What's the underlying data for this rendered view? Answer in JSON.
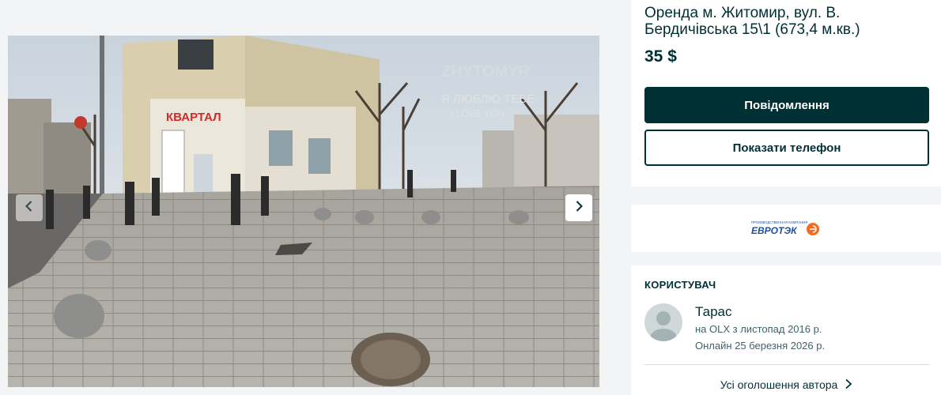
{
  "listing": {
    "title": "Оренда м. Житомир, вул. В. Бердичівська 15\\1 (673,4 м.кв.)",
    "price": "35 $"
  },
  "actions": {
    "message_label": "Повідомлення",
    "show_phone_label": "Показати телефон"
  },
  "gallery": {
    "photo_sign_shop": "КВАРТАЛ",
    "photo_sign_city": "ZHYTOMYR",
    "photo_sign_love_ua": "Я ЛЮБЛЮ ТЕБЕ",
    "photo_sign_love_en": "I LOVE YOU",
    "prev_icon": "chevron-left-icon",
    "next_icon": "chevron-right-icon"
  },
  "company": {
    "logo_text": "ЕВРОТЭК",
    "logo_tagline": "ПРОИЗВОДСТВЕННАЯ КОМПАНИЯ"
  },
  "user": {
    "heading": "КОРИСТУВАЧ",
    "name": "Тарас",
    "since": "на OLX з листопад 2016 р.",
    "online": "Онлайн 25 березня 2026 р.",
    "all_ads_label": "Усі оголошення автора"
  },
  "colors": {
    "primary": "#002f34",
    "background": "#f2f4f5",
    "logo_blue": "#1f4e9c",
    "logo_orange": "#f26b21"
  }
}
